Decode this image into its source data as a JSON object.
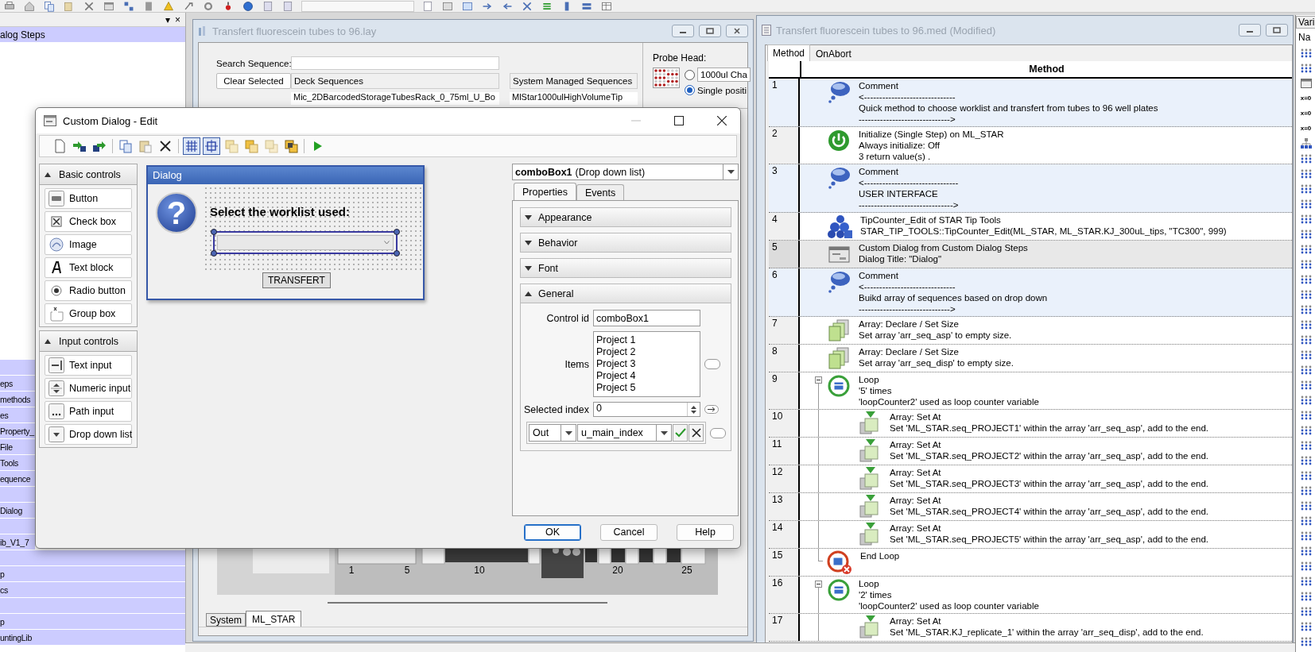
{
  "left_panel": {
    "header_buttons": [
      "▾",
      "×"
    ],
    "top_groups": [
      {
        "label": "alog Steps"
      }
    ],
    "bottom_groups": [
      {
        "kind": "blank"
      },
      {
        "kind": "group",
        "label": "eps"
      },
      {
        "kind": "group",
        "label": "methods"
      },
      {
        "kind": "group",
        "label": "es"
      },
      {
        "kind": "group",
        "label": "Property_"
      },
      {
        "kind": "group",
        "label": "File"
      },
      {
        "kind": "group",
        "label": "Tools"
      },
      {
        "kind": "group",
        "label": "equence"
      },
      {
        "kind": "blank"
      },
      {
        "kind": "group",
        "label": "Dialog"
      },
      {
        "kind": "blank"
      },
      {
        "kind": "group",
        "label": "ib_V1_7"
      },
      {
        "kind": "blank"
      },
      {
        "kind": "group",
        "label": "p"
      },
      {
        "kind": "group",
        "label": "cs"
      },
      {
        "kind": "blank"
      },
      {
        "kind": "group",
        "label": "p"
      },
      {
        "kind": "group",
        "label": "untingLib"
      }
    ]
  },
  "deck_window": {
    "title": "Transfert fluorescein tubes to 96.lay",
    "search_label": "Search Sequence:",
    "clear_button": "Clear Selected",
    "deck_header": "Deck Sequences",
    "system_header": "System Managed Sequences",
    "deck_rows": [
      "Mic_2DBarcodedStorageTubesRack_0_75ml_U_Bo"
    ],
    "system_rows": [
      "MlStar1000ulHighVolumeTip"
    ],
    "probe_head": {
      "label": "Probe Head:",
      "options": [
        {
          "label": "1000ul Cha",
          "kind": "field",
          "selected": false
        },
        {
          "label": "Single positi",
          "kind": "plain",
          "selected": true
        }
      ]
    },
    "deck_positions": [
      {
        "label": "1"
      },
      {
        "label": "5"
      },
      {
        "label": "10"
      },
      {
        "label": "20"
      },
      {
        "label": "25"
      }
    ],
    "tabs": [
      {
        "label": "System",
        "selected": false
      },
      {
        "label": "ML_STAR",
        "selected": true
      }
    ]
  },
  "dialog": {
    "title": "Custom Dialog - Edit",
    "toolbar": [
      {
        "kind": "new",
        "on": false
      },
      {
        "kind": "import",
        "on": false
      },
      {
        "kind": "export",
        "on": false
      },
      {
        "kind": "copy",
        "on": false
      },
      {
        "kind": "paste",
        "on": false
      },
      {
        "kind": "delete",
        "on": false
      },
      {
        "kind": "grid",
        "on": true
      },
      {
        "kind": "snap",
        "on": true
      },
      {
        "kind": "front",
        "on": false
      },
      {
        "kind": "forward",
        "on": false
      },
      {
        "kind": "backward",
        "on": false
      },
      {
        "kind": "back",
        "on": false
      },
      {
        "kind": "run",
        "on": false
      }
    ],
    "palette": [
      {
        "title": "Basic controls",
        "expanded": true,
        "items": [
          {
            "label": "Button",
            "kind": "button"
          },
          {
            "label": "Check box",
            "kind": "checkbox"
          },
          {
            "label": "Image",
            "kind": "image"
          },
          {
            "label": "Text block",
            "kind": "textblock"
          },
          {
            "label": "Radio button",
            "kind": "radio"
          },
          {
            "label": "Group box",
            "kind": "groupbox"
          }
        ]
      },
      {
        "title": "Input controls",
        "expanded": true,
        "items": [
          {
            "label": "Text input",
            "kind": "textinput"
          },
          {
            "label": "Numeric input",
            "kind": "numeric"
          },
          {
            "label": "Path input",
            "kind": "path"
          },
          {
            "label": "Drop down list",
            "kind": "dropdown"
          }
        ]
      }
    ],
    "preview": {
      "title": "Dialog",
      "icon": "?",
      "prompt": "Select the worklist used:",
      "button": "TRANSFERT"
    },
    "properties": {
      "control_name": "comboBox1",
      "control_type": "(Drop down list)",
      "tabs": [
        {
          "label": "Properties",
          "selected": true
        },
        {
          "label": "Events",
          "selected": false
        }
      ],
      "sections": [
        {
          "label": "Appearance",
          "expanded": false
        },
        {
          "label": "Behavior",
          "expanded": false
        },
        {
          "label": "Font",
          "expanded": false
        },
        {
          "label": "General",
          "expanded": true
        }
      ],
      "control_id_label": "Control id",
      "control_id": "comboBox1",
      "items_label": "Items",
      "items": [
        "Project 1",
        "Project 2",
        "Project 3",
        "Project 4",
        "Project 5"
      ],
      "items_binding": {
        "on": false
      },
      "index_binding": {
        "on": false
      },
      "selected_index_label": "Selected index",
      "selected_index": "0",
      "direction": "Out",
      "variable": "u_main_index"
    },
    "buttons": [
      "OK",
      "Cancel",
      "Help"
    ]
  },
  "method_window": {
    "title": "Transfert fluorescein tubes to 96.med (Modified)",
    "tabs": [
      {
        "label": "Method",
        "selected": true
      },
      {
        "label": "OnAbort",
        "selected": false
      }
    ],
    "column": "Method",
    "steps": [
      {
        "number": "1",
        "kind": "comment",
        "selected": false,
        "lines": [
          "Comment",
          "<------------------------------",
          "Quick method to choose worklist and transfert from tubes to 96 well plates",
          "------------------------------>"
        ]
      },
      {
        "number": "2",
        "kind": "initialize",
        "selected": false,
        "lines": [
          "Initialize (Single Step) on ML_STAR",
          "Always initialize: Off",
          "3 return value(s) ."
        ]
      },
      {
        "number": "3",
        "kind": "comment",
        "selected": false,
        "lines": [
          "Comment",
          "<-------------------------------",
          "USER INTERFACE",
          "------------------------------->"
        ]
      },
      {
        "number": "4",
        "kind": "tipcounter",
        "selected": false,
        "lines": [
          "TipCounter_Edit of STAR Tip Tools",
          "STAR_TIP_TOOLS::TipCounter_Edit(ML_STAR, ML_STAR.KJ_300uL_tips, \"TC300\", 999)"
        ]
      },
      {
        "number": "5",
        "kind": "dialog",
        "selected": true,
        "lines": [
          "Custom Dialog from Custom Dialog Steps",
          "Dialog Title: \"Dialog\""
        ]
      },
      {
        "number": "6",
        "kind": "comment",
        "selected": false,
        "lines": [
          "Comment",
          "<------------------------------",
          "Buikd array of sequences based on drop down",
          "------------------------------>"
        ]
      },
      {
        "number": "7",
        "kind": "array_declare",
        "selected": false,
        "lines": [
          "Array: Declare / Set Size",
          "Set array 'arr_seq_asp' to empty size."
        ]
      },
      {
        "number": "8",
        "kind": "array_declare",
        "selected": false,
        "lines": [
          "Array: Declare / Set Size",
          "Set array 'arr_seq_disp' to empty size."
        ]
      },
      {
        "number": "9",
        "kind": "loop",
        "selected": false,
        "expanded": true,
        "lines": [
          "Loop",
          "'5' times",
          "'loopCounter2' used as loop counter variable"
        ],
        "children": [
          {
            "number": "10",
            "kind": "array_set",
            "selected": false,
            "lines": [
              "Array: Set At",
              "Set 'ML_STAR.seq_PROJECT1' within the array 'arr_seq_asp', add to the end."
            ]
          },
          {
            "number": "11",
            "kind": "array_set",
            "selected": false,
            "lines": [
              "Array: Set At",
              "Set 'ML_STAR.seq_PROJECT2' within the array 'arr_seq_asp', add to the end."
            ]
          },
          {
            "number": "12",
            "kind": "array_set",
            "selected": false,
            "lines": [
              "Array: Set At",
              "Set 'ML_STAR.seq_PROJECT3' within the array 'arr_seq_asp', add to the end."
            ]
          },
          {
            "number": "13",
            "kind": "array_set",
            "selected": false,
            "lines": [
              "Array: Set At",
              "Set 'ML_STAR.seq_PROJECT4' within the array 'arr_seq_asp', add to the end."
            ]
          },
          {
            "number": "14",
            "kind": "array_set",
            "selected": false,
            "lines": [
              "Array: Set At",
              "Set 'ML_STAR.seq_PROJECT5' within the array 'arr_seq_asp', add to the end."
            ]
          }
        ]
      },
      {
        "number": "15",
        "kind": "end_loop",
        "selected": false,
        "lines": [
          "End Loop"
        ]
      },
      {
        "number": "16",
        "kind": "loop",
        "selected": false,
        "expanded": true,
        "lines": [
          "Loop",
          "'2' times",
          "'loopCounter2' used as loop counter variable"
        ],
        "children": [
          {
            "number": "17",
            "kind": "array_set",
            "selected": false,
            "lines": [
              "Array: Set At",
              "Set 'ML_STAR.KJ_replicate_1' within the array 'arr_seq_disp', add to the end."
            ]
          }
        ]
      }
    ]
  },
  "variables_panel": {
    "title": "Vari",
    "column": "Na",
    "items": [
      {
        "kind": "grid"
      },
      {
        "kind": "grid"
      },
      {
        "kind": "window"
      },
      {
        "kind": "assign",
        "label": "x=0"
      },
      {
        "kind": "assign",
        "label": "x=0"
      },
      {
        "kind": "assign",
        "label": "x=0"
      },
      {
        "kind": "tree"
      },
      {
        "kind": "grid"
      },
      {
        "kind": "grid"
      },
      {
        "kind": "grid"
      },
      {
        "kind": "grid"
      },
      {
        "kind": "grid"
      },
      {
        "kind": "grid"
      },
      {
        "kind": "grid"
      },
      {
        "kind": "grid"
      },
      {
        "kind": "grid"
      },
      {
        "kind": "grid"
      },
      {
        "kind": "grid"
      },
      {
        "kind": "grid"
      },
      {
        "kind": "grid"
      },
      {
        "kind": "grid"
      },
      {
        "kind": "grid"
      },
      {
        "kind": "grid"
      },
      {
        "kind": "grid"
      },
      {
        "kind": "grid"
      },
      {
        "kind": "grid"
      },
      {
        "kind": "grid"
      },
      {
        "kind": "grid"
      },
      {
        "kind": "grid"
      },
      {
        "kind": "grid"
      },
      {
        "kind": "grid"
      },
      {
        "kind": "grid"
      },
      {
        "kind": "grid"
      },
      {
        "kind": "grid"
      },
      {
        "kind": "grid"
      },
      {
        "kind": "grid"
      },
      {
        "kind": "grid"
      },
      {
        "kind": "grid"
      },
      {
        "kind": "grid"
      },
      {
        "kind": "grid"
      }
    ]
  }
}
